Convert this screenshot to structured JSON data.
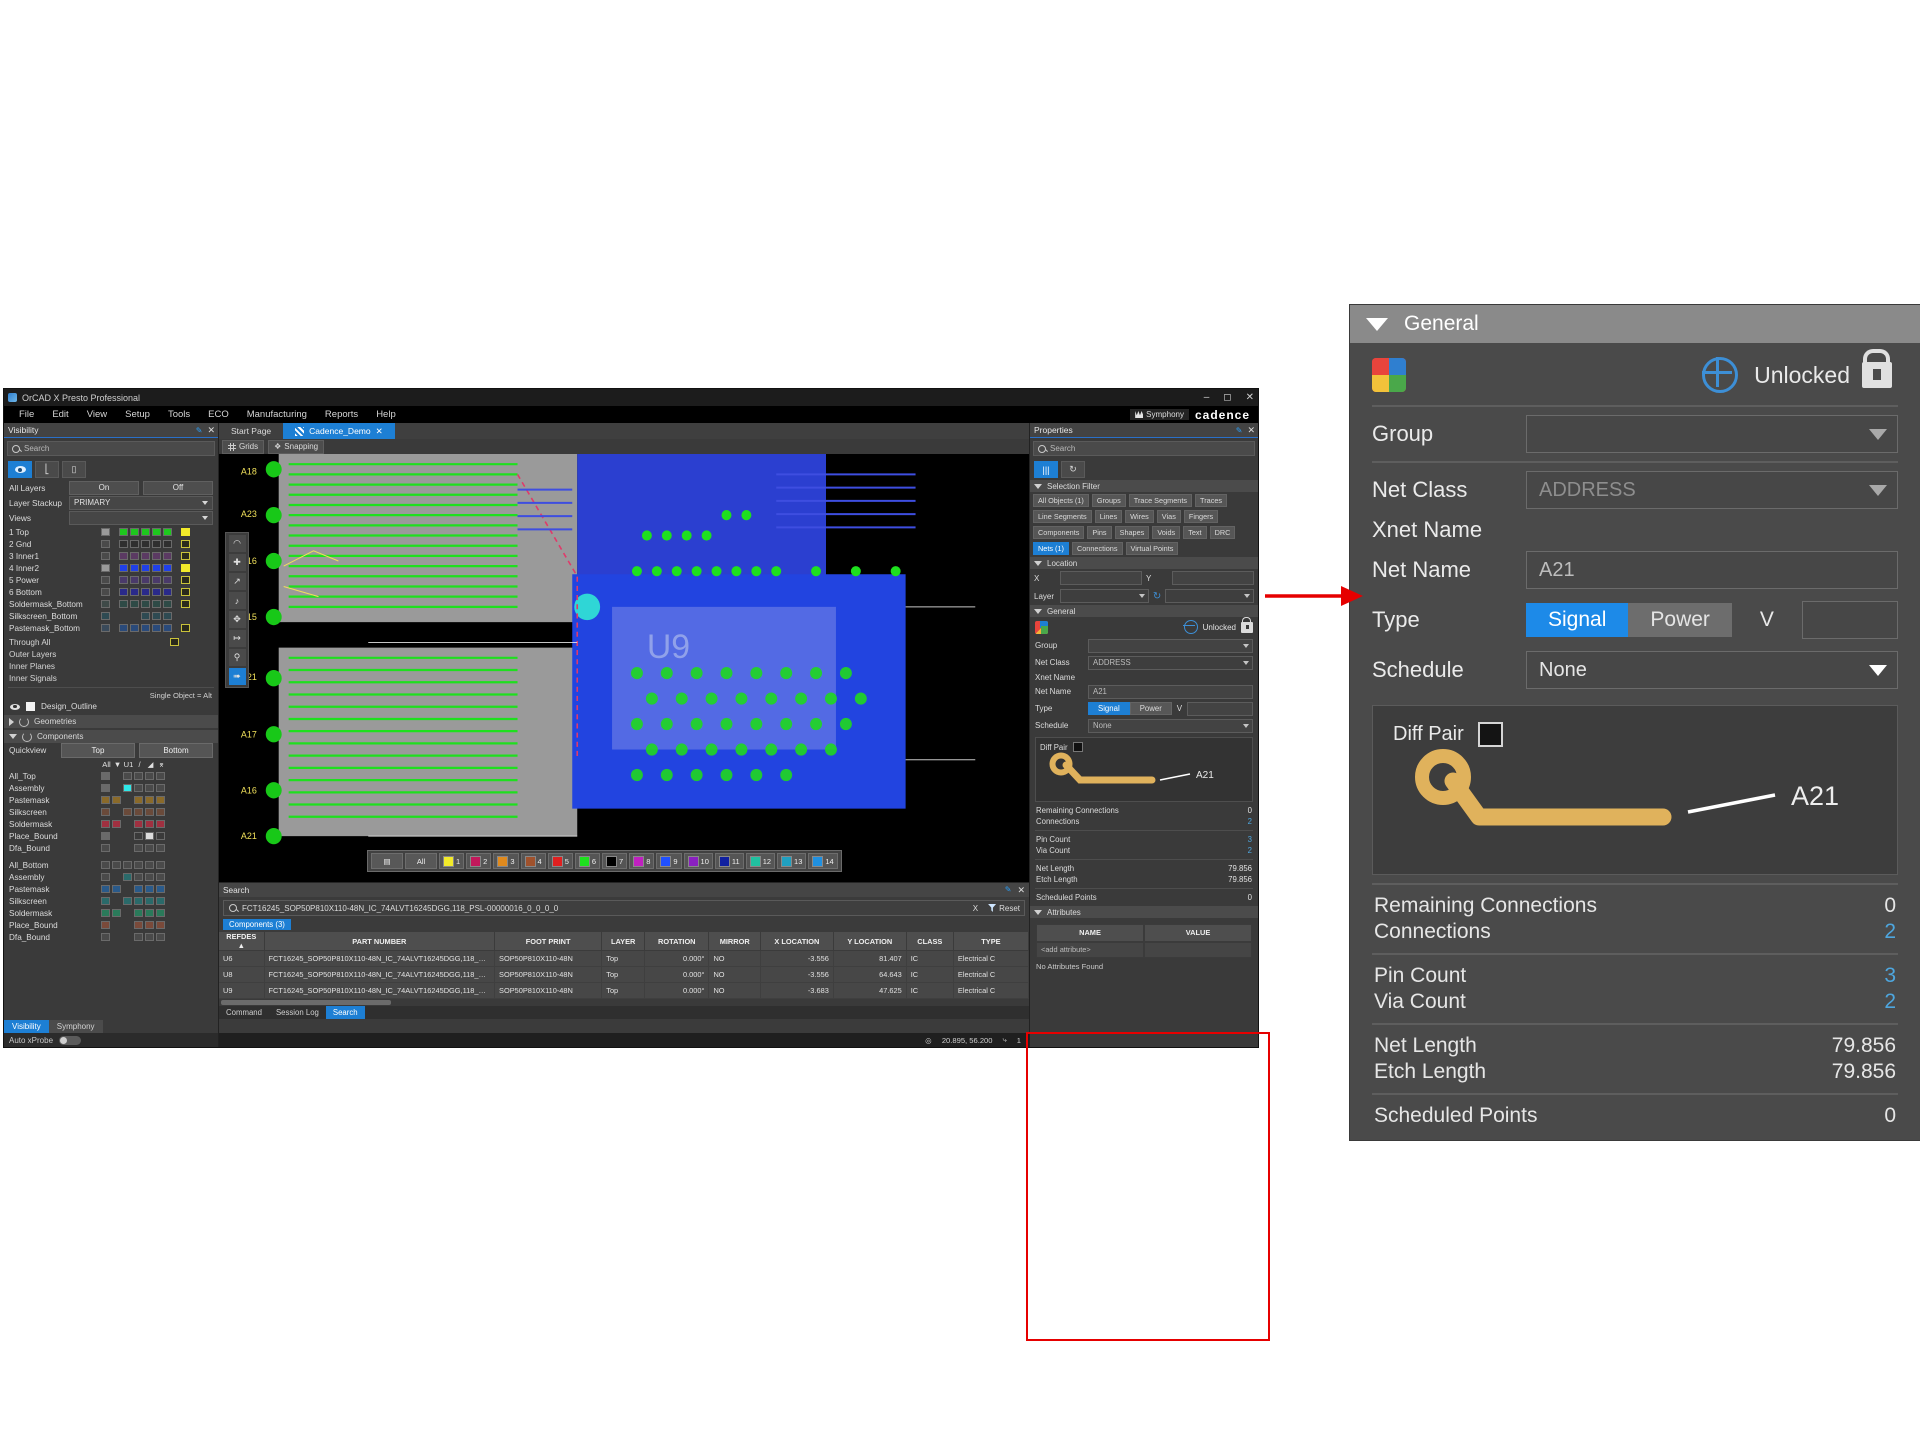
{
  "app": {
    "title": "OrCAD X Presto Professional",
    "window_buttons": [
      "minimize",
      "maximize",
      "close"
    ],
    "menu": [
      "File",
      "Edit",
      "View",
      "Setup",
      "Tools",
      "ECO",
      "Manufacturing",
      "Reports",
      "Help"
    ],
    "symphony_label": "Symphony",
    "brand": "cadence"
  },
  "visibility": {
    "title": "Visibility",
    "search_placeholder": "Search",
    "all_layers_label": "All Layers",
    "on_label": "On",
    "off_label": "Off",
    "layer_stackup_label": "Layer Stackup",
    "layer_stackup_value": "PRIMARY",
    "views_label": "Views",
    "views_value": "",
    "layers": [
      {
        "name": "1 Top",
        "main": "#9a9a9a",
        "cells": [
          "#1ec81e",
          "#1ec81e",
          "#1ec81e",
          "#1ec81e",
          "#1ec81e"
        ],
        "last": "#f2ea2a"
      },
      {
        "name": "2 Gnd",
        "main": "#4a4a4a",
        "cells": [
          "#2f2f2f",
          "#2f2f2f",
          "#2f2f2f",
          "#2f2f2f",
          "#2f2f2f"
        ],
        "last": "#3a3a24"
      },
      {
        "name": "3 Inner1",
        "main": "#4a4a4a",
        "cells": [
          "#5b3a63",
          "#5b3a63",
          "#5b3a63",
          "#5b3a63",
          "#5b3a63"
        ],
        "last": "#3a3a24"
      },
      {
        "name": "4 Inner2",
        "main": "#9a9a9a",
        "cells": [
          "#2040e8",
          "#2040e8",
          "#2040e8",
          "#2040e8",
          "#2040e8"
        ],
        "last": "#f2ea2a"
      },
      {
        "name": "5 Power",
        "main": "#4a4a4a",
        "cells": [
          "#4a3a6a",
          "#4a3a6a",
          "#4a3a6a",
          "#4a3a6a",
          "#4a3a6a"
        ],
        "last": "#3a3a24"
      },
      {
        "name": "6 Bottom",
        "main": "#4a4a4a",
        "cells": [
          "#2a2a8a",
          "#2a2a8a",
          "#2a2a8a",
          "#2a2a8a",
          "#2a2a8a"
        ],
        "last": "#3a3a24"
      },
      {
        "name": "Soldermask_Bottom",
        "main": "#3f4a48",
        "cells": [
          "#2e4a46",
          "#2e4a46",
          "#2e4a46",
          "#2e4a46",
          "#2e4a46"
        ],
        "last": "#3a3a24"
      },
      {
        "name": "Silkscreen_Bottom",
        "main": "#2e4a52",
        "cells": [
          "",
          "",
          "#2e4a52",
          "#2e4a52",
          "#2e4a52"
        ],
        "last": ""
      },
      {
        "name": "Pastemask_Bottom",
        "main": "#3a4a5a",
        "cells": [
          "#2a4a7a",
          "#2a4a7a",
          "#2a4a7a",
          "#2a4a7a",
          "#2a4a7a"
        ],
        "last": "#3a3a24"
      }
    ],
    "groups": [
      "Through All",
      "Outer Layers",
      "Inner Planes",
      "Inner Signals"
    ],
    "single_object_hint": "Single Object = Alt",
    "design_outline": "Design_Outline",
    "geometries_label": "Geometries",
    "components_label": "Components",
    "quickview_label": "Quickview",
    "top_label": "Top",
    "bottom_label": "Bottom",
    "column_headers": [
      "All",
      "filter-icon",
      "U1",
      "/",
      "fill-icon",
      "text-icon"
    ],
    "component_rows_top": [
      "All_Top",
      "Assembly",
      "Pastemask",
      "Silkscreen",
      "Soldermask",
      "Place_Bound",
      "Dfa_Bound"
    ],
    "component_rows_bottom": [
      "All_Bottom",
      "Assembly",
      "Pastemask",
      "Silkscreen",
      "Soldermask",
      "Place_Bound",
      "Dfa_Bound"
    ],
    "tabs": [
      "Visibility",
      "Symphony"
    ],
    "active_tab": "Visibility",
    "auto_xprobe_label": "Auto xProbe"
  },
  "center": {
    "tabs": [
      {
        "label": "Start Page",
        "active": false
      },
      {
        "label": "Cadence_Demo",
        "active": true
      }
    ],
    "toolbar": [
      "Grids",
      "Snapping"
    ],
    "layer_strip": {
      "all_label": "All",
      "chips": [
        {
          "num": "1",
          "color": "#f2ea2a"
        },
        {
          "num": "2",
          "color": "#c2185b"
        },
        {
          "num": "3",
          "color": "#e08a1e"
        },
        {
          "num": "4",
          "color": "#a0522d"
        },
        {
          "num": "5",
          "color": "#e02020"
        },
        {
          "num": "6",
          "color": "#1ee01e"
        },
        {
          "num": "7",
          "color": "#000000"
        },
        {
          "num": "8",
          "color": "#c020c0"
        },
        {
          "num": "9",
          "color": "#2050ff"
        },
        {
          "num": "10",
          "color": "#8a20c0"
        },
        {
          "num": "11",
          "color": "#1020a0"
        },
        {
          "num": "12",
          "color": "#20c0a0"
        },
        {
          "num": "13",
          "color": "#20a0c0"
        },
        {
          "num": "14",
          "color": "#2090e0"
        }
      ]
    }
  },
  "search_dock": {
    "title": "Search",
    "query": "FCT16245_SOP50P810X110-48N_IC_74ALVT16245DGG,118_PSL-00000016_0_0_0_0",
    "clear_label": "X",
    "reset_label": "Reset",
    "result_chip": "Components (3)",
    "columns": [
      "REFDES",
      "PART NUMBER",
      "FOOT PRINT",
      "LAYER",
      "ROTATION",
      "MIRROR",
      "X LOCATION",
      "Y LOCATION",
      "CLASS",
      "TYPE"
    ],
    "sort_column": "REFDES",
    "rows": [
      {
        "refdes": "U6",
        "part_number": "FCT16245_SOP50P810X110-48N_IC_74ALVT16245DGG,118_PSL...",
        "foot_print": "SOP50P810X110-48N",
        "layer": "Top",
        "rotation": "0.000°",
        "mirror": "NO",
        "x": "-3.556",
        "y": "81.407",
        "class": "IC",
        "type": "Electrical C"
      },
      {
        "refdes": "U8",
        "part_number": "FCT16245_SOP50P810X110-48N_IC_74ALVT16245DGG,118_PSL...",
        "foot_print": "SOP50P810X110-48N",
        "layer": "Top",
        "rotation": "0.000°",
        "mirror": "NO",
        "x": "-3.556",
        "y": "64.643",
        "class": "IC",
        "type": "Electrical C"
      },
      {
        "refdes": "U9",
        "part_number": "FCT16245_SOP50P810X110-48N_IC_74ALVT16245DGG,118_PSL...",
        "foot_print": "SOP50P810X110-48N",
        "layer": "Top",
        "rotation": "0.000°",
        "mirror": "NO",
        "x": "-3.683",
        "y": "47.625",
        "class": "IC",
        "type": "Electrical C"
      }
    ],
    "bottom_tabs": [
      "Command",
      "Session Log",
      "Search"
    ],
    "active_bottom_tab": "Search"
  },
  "status_bar": {
    "coordinates": "20.895, 56.200",
    "units": "1"
  },
  "properties": {
    "title": "Properties",
    "search_placeholder": "Search",
    "selection_filter_label": "Selection Filter",
    "filters": [
      {
        "label": "All Objects (1)",
        "on": false
      },
      {
        "label": "Groups",
        "on": false
      },
      {
        "label": "Trace Segments",
        "on": false
      },
      {
        "label": "Traces",
        "on": false
      },
      {
        "label": "Line Segments",
        "on": false
      },
      {
        "label": "Lines",
        "on": false
      },
      {
        "label": "Wires",
        "on": false
      },
      {
        "label": "Vias",
        "on": false
      },
      {
        "label": "Fingers",
        "on": false
      },
      {
        "label": "Components",
        "on": false
      },
      {
        "label": "Pins",
        "on": false
      },
      {
        "label": "Shapes",
        "on": false
      },
      {
        "label": "Voids",
        "on": false
      },
      {
        "label": "Text",
        "on": false
      },
      {
        "label": "DRC",
        "on": false
      },
      {
        "label": "Nets (1)",
        "on": true
      },
      {
        "label": "Connections",
        "on": false
      },
      {
        "label": "Virtual Points",
        "on": false
      }
    ],
    "location_label": "Location",
    "x_label": "X",
    "x_value": "",
    "y_label": "Y",
    "y_value": "",
    "layer_label": "Layer",
    "layer_value": "",
    "attributes_label": "Attributes",
    "attr_name_header": "NAME",
    "attr_value_header": "VALUE",
    "add_attribute": "<add attribute>",
    "no_attributes": "No Attributes Found"
  },
  "general_panel": {
    "section_title": "General",
    "lock_status": "Unlocked",
    "group_label": "Group",
    "group_value": "",
    "net_class_label": "Net Class",
    "net_class_value": "ADDRESS",
    "xnet_name_label": "Xnet Name",
    "xnet_name_value": "",
    "net_name_label": "Net Name",
    "net_name_value": "A21",
    "type_label": "Type",
    "type_signal": "Signal",
    "type_power": "Power",
    "type_v_label": "V",
    "type_v_value": "",
    "type_selected": "Signal",
    "schedule_label": "Schedule",
    "schedule_value": "None",
    "diff_pair_label": "Diff Pair",
    "diff_pair_checked": false,
    "diagram_net_label": "A21",
    "stats": [
      {
        "label": "Remaining Connections",
        "value": "0",
        "accent": false
      },
      {
        "label": "Connections",
        "value": "2",
        "accent": true
      },
      {
        "label": "Pin Count",
        "value": "3",
        "accent": true
      },
      {
        "label": "Via Count",
        "value": "2",
        "accent": true
      },
      {
        "label": "Net Length",
        "value": "79.856",
        "accent": false
      },
      {
        "label": "Etch Length",
        "value": "79.856",
        "accent": false
      },
      {
        "label": "Scheduled Points",
        "value": "0",
        "accent": false
      }
    ]
  },
  "colors": {
    "accent_blue": "#1d7fd4",
    "highlight_red": "#e60000",
    "panel_bg": "#3a3a3a",
    "big_panel_bg": "#4a4a4a"
  }
}
